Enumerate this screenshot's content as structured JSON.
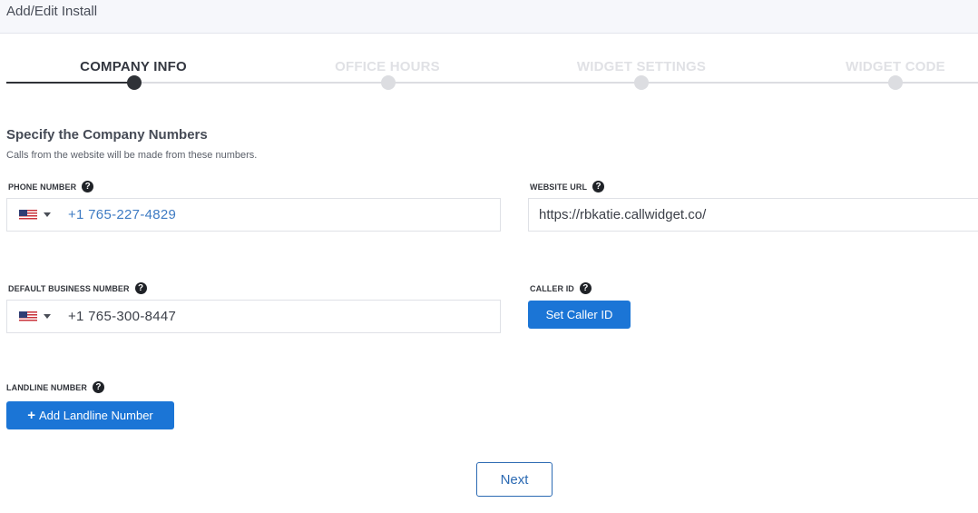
{
  "header": {
    "title": "Add/Edit Install"
  },
  "stepper": {
    "steps": [
      {
        "label": "COMPANY INFO",
        "state": "active"
      },
      {
        "label": "OFFICE HOURS",
        "state": "upcoming"
      },
      {
        "label": "WIDGET SETTINGS",
        "state": "upcoming"
      },
      {
        "label": "WIDGET CODE",
        "state": "upcoming"
      }
    ]
  },
  "section": {
    "title": "Specify the Company Numbers",
    "subtitle": "Calls from the website will be made from these numbers."
  },
  "fields": {
    "phone_number": {
      "label": "PHONE NUMBER",
      "country": "US",
      "value": "+1 765-227-4829"
    },
    "website_url": {
      "label": "WEBSITE URL",
      "value": "https://rbkatie.callwidget.co/"
    },
    "default_business_number": {
      "label": "DEFAULT BUSINESS NUMBER",
      "country": "US",
      "value": "+1 765-300-8447"
    },
    "caller_id": {
      "label": "CALLER ID",
      "button_label": "Set Caller ID"
    },
    "landline_number": {
      "label": "LANDLINE NUMBER",
      "button_label": "Add Landline Number"
    }
  },
  "actions": {
    "next_label": "Next"
  },
  "colors": {
    "primary": "#1b75d6",
    "active_step": "#2f3237",
    "inactive_step": "#dcdde1",
    "link_blue": "#3e7bc3"
  }
}
